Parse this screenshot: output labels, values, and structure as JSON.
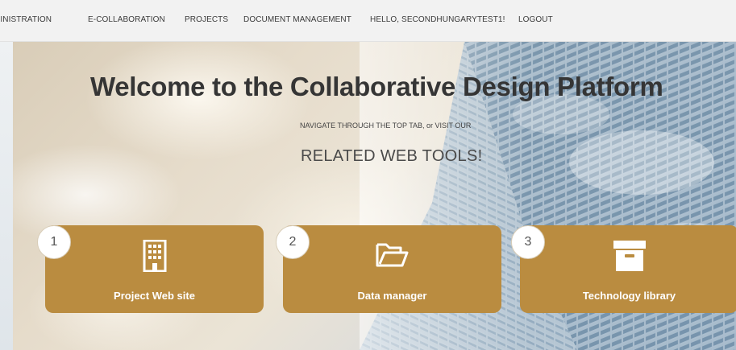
{
  "nav": {
    "items": [
      {
        "label": "MINISTRATION"
      },
      {
        "label": "E-COLLABORATION"
      },
      {
        "label": "PROJECTS"
      },
      {
        "label": "DOCUMENT MANAGEMENT"
      },
      {
        "label": "HELLO, SECONDHUNGARYTEST1!"
      },
      {
        "label": "LOGOUT"
      }
    ]
  },
  "hero": {
    "title": "Welcome to the Collaborative Design Platform",
    "subtitle": "NAVIGATE THROUGH THE TOP TAB, or VISIT OUR",
    "tagline": "RELATED WEB TOOLS!"
  },
  "tiles": [
    {
      "number": "1",
      "label": "Project Web site",
      "icon": "building-icon"
    },
    {
      "number": "2",
      "label": "Data manager",
      "icon": "folder-open-icon"
    },
    {
      "number": "3",
      "label": "Technology library",
      "icon": "archive-box-icon"
    }
  ],
  "colors": {
    "tile": "#ba8c40",
    "nav_bg": "#f2f2f2",
    "title": "#353535"
  }
}
